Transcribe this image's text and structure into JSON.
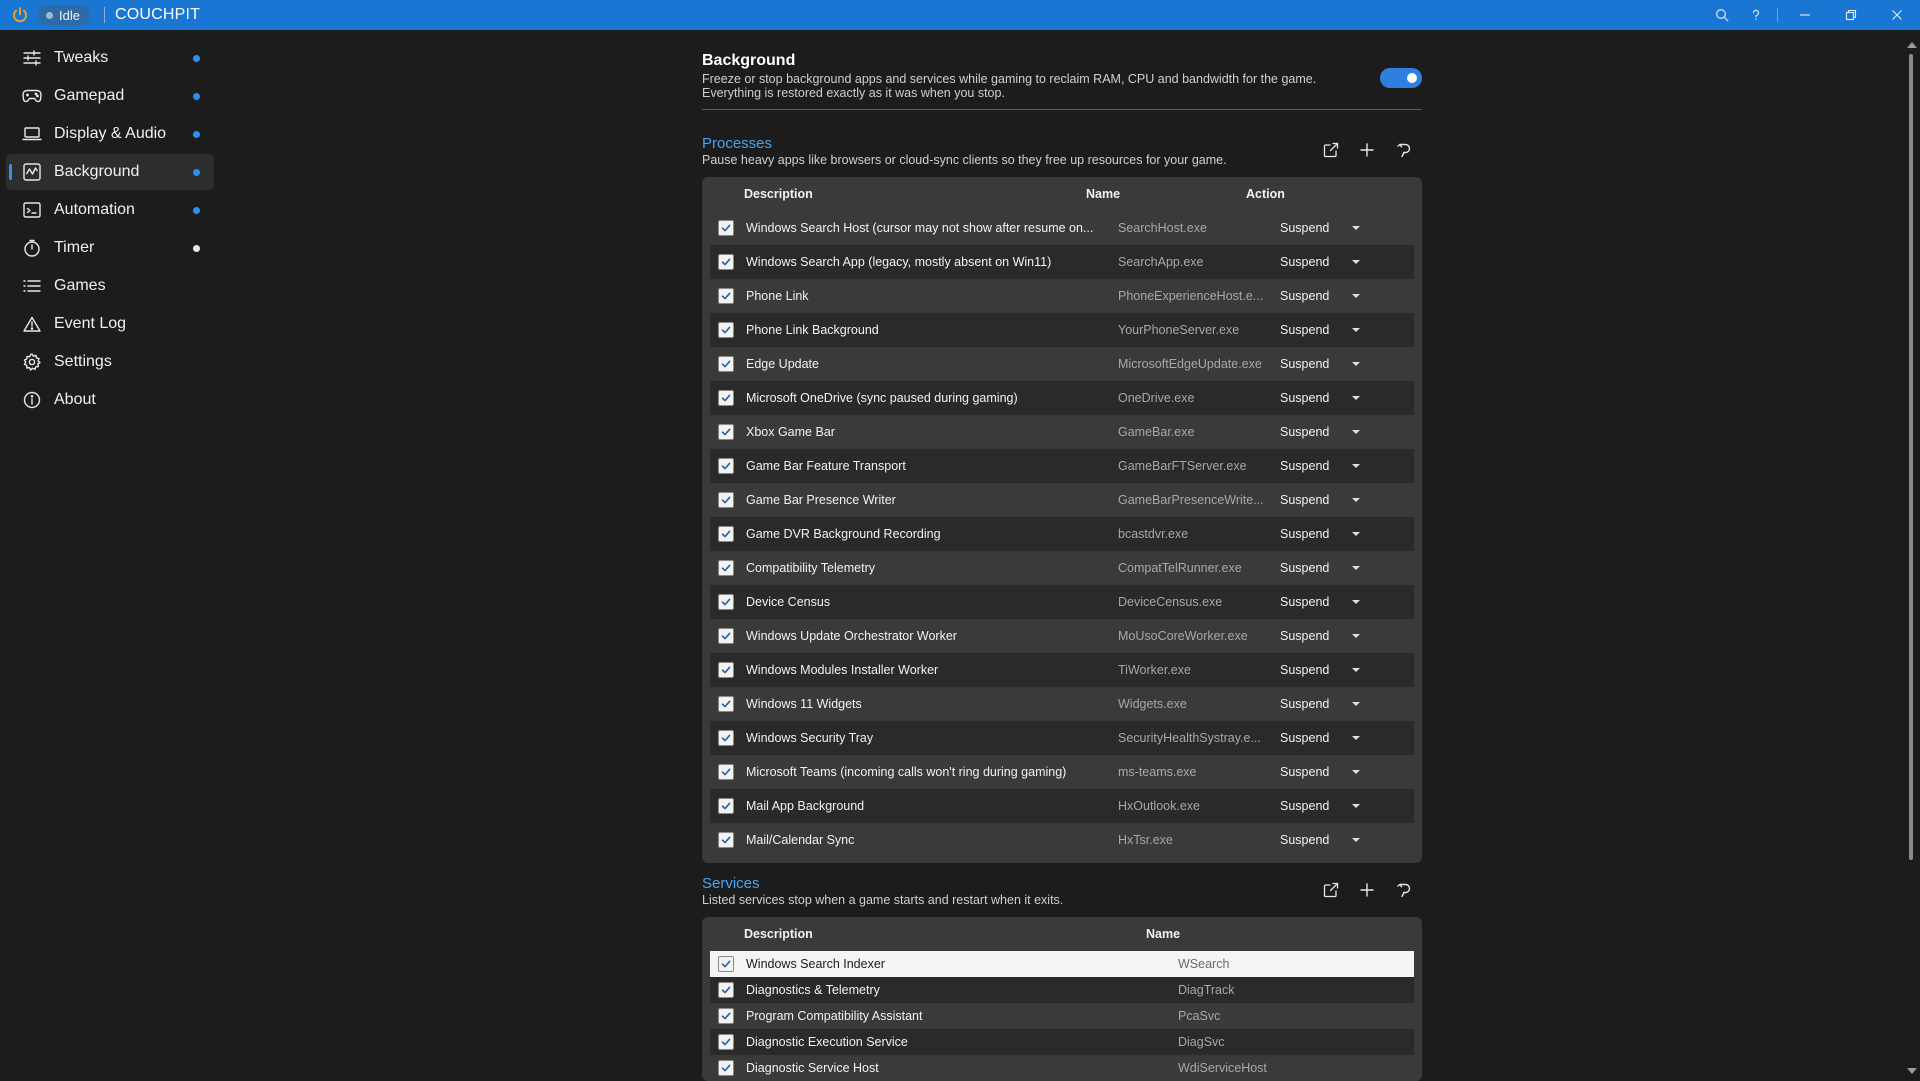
{
  "app": {
    "status": "Idle",
    "title": "COUCHPIT"
  },
  "sidebar": {
    "items": [
      {
        "label": "Tweaks",
        "icon": "sliders-icon",
        "dot": "blue"
      },
      {
        "label": "Gamepad",
        "icon": "gamepad-icon",
        "dot": "blue"
      },
      {
        "label": "Display & Audio",
        "icon": "laptop-icon",
        "dot": "blue"
      },
      {
        "label": "Background",
        "icon": "chart-icon",
        "dot": "blue",
        "active": true
      },
      {
        "label": "Automation",
        "icon": "automation-icon",
        "dot": "blue"
      },
      {
        "label": "Timer",
        "icon": "timer-icon",
        "dot": "white"
      },
      {
        "label": "Games",
        "icon": "list-icon"
      },
      {
        "label": "Event Log",
        "icon": "warning-icon"
      },
      {
        "label": "Settings",
        "icon": "gear-icon"
      },
      {
        "label": "About",
        "icon": "info-icon"
      }
    ]
  },
  "background": {
    "title": "Background",
    "description": "Freeze or stop background apps and services while gaming to reclaim RAM, CPU and bandwidth for the game. Everything is restored exactly as it was when you stop.",
    "enabled": true
  },
  "processes": {
    "title": "Processes",
    "description": "Pause heavy apps like browsers or cloud-sync clients so they free up resources for your game.",
    "headers": {
      "description": "Description",
      "name": "Name",
      "action": "Action"
    },
    "rows": [
      {
        "description": "Windows Search Host (cursor may not show after resume on...",
        "name": "SearchHost.exe",
        "action": "Suspend"
      },
      {
        "description": "Windows Search App (legacy, mostly absent on Win11)",
        "name": "SearchApp.exe",
        "action": "Suspend"
      },
      {
        "description": "Phone Link",
        "name": "PhoneExperienceHost.e...",
        "action": "Suspend"
      },
      {
        "description": "Phone Link Background",
        "name": "YourPhoneServer.exe",
        "action": "Suspend"
      },
      {
        "description": "Edge Update",
        "name": "MicrosoftEdgeUpdate.exe",
        "action": "Suspend"
      },
      {
        "description": "Microsoft OneDrive (sync paused during gaming)",
        "name": "OneDrive.exe",
        "action": "Suspend"
      },
      {
        "description": "Xbox Game Bar",
        "name": "GameBar.exe",
        "action": "Suspend"
      },
      {
        "description": "Game Bar Feature Transport",
        "name": "GameBarFTServer.exe",
        "action": "Suspend"
      },
      {
        "description": "Game Bar Presence Writer",
        "name": "GameBarPresenceWrite...",
        "action": "Suspend"
      },
      {
        "description": "Game DVR Background Recording",
        "name": "bcastdvr.exe",
        "action": "Suspend"
      },
      {
        "description": "Compatibility Telemetry",
        "name": "CompatTelRunner.exe",
        "action": "Suspend"
      },
      {
        "description": "Device Census",
        "name": "DeviceCensus.exe",
        "action": "Suspend"
      },
      {
        "description": "Windows Update Orchestrator Worker",
        "name": "MoUsoCoreWorker.exe",
        "action": "Suspend"
      },
      {
        "description": "Windows Modules Installer Worker",
        "name": "TiWorker.exe",
        "action": "Suspend"
      },
      {
        "description": "Windows 11 Widgets",
        "name": "Widgets.exe",
        "action": "Suspend"
      },
      {
        "description": "Windows Security Tray",
        "name": "SecurityHealthSystray.e...",
        "action": "Suspend"
      },
      {
        "description": "Microsoft Teams (incoming calls won't ring during gaming)",
        "name": "ms-teams.exe",
        "action": "Suspend"
      },
      {
        "description": "Mail App Background",
        "name": "HxOutlook.exe",
        "action": "Suspend"
      },
      {
        "description": "Mail/Calendar Sync",
        "name": "HxTsr.exe",
        "action": "Suspend"
      }
    ]
  },
  "services": {
    "title": "Services",
    "description": "Listed services stop when a game starts and restart when it exits.",
    "headers": {
      "description": "Description",
      "name": "Name"
    },
    "rows": [
      {
        "description": "Windows Search Indexer",
        "name": "WSearch",
        "highlighted": true
      },
      {
        "description": "Diagnostics & Telemetry",
        "name": "DiagTrack"
      },
      {
        "description": "Program Compatibility Assistant",
        "name": "PcaSvc"
      },
      {
        "description": "Diagnostic Execution Service",
        "name": "DiagSvc"
      },
      {
        "description": "Diagnostic Service Host",
        "name": "WdiServiceHost"
      }
    ]
  }
}
